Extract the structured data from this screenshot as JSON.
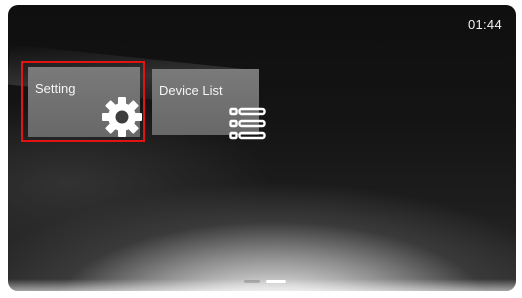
{
  "status_bar": {
    "time": "01:44"
  },
  "tiles": [
    {
      "label": "Setting",
      "icon": "gear-icon",
      "selected": true
    },
    {
      "label": "Device List",
      "icon": "list-icon",
      "selected": false
    }
  ],
  "page_indicator": {
    "pages": 2,
    "current": 2
  },
  "colors": {
    "selection_border": "#e21313",
    "tile_background": "#6f6f6f",
    "text": "#f5f5f5"
  }
}
